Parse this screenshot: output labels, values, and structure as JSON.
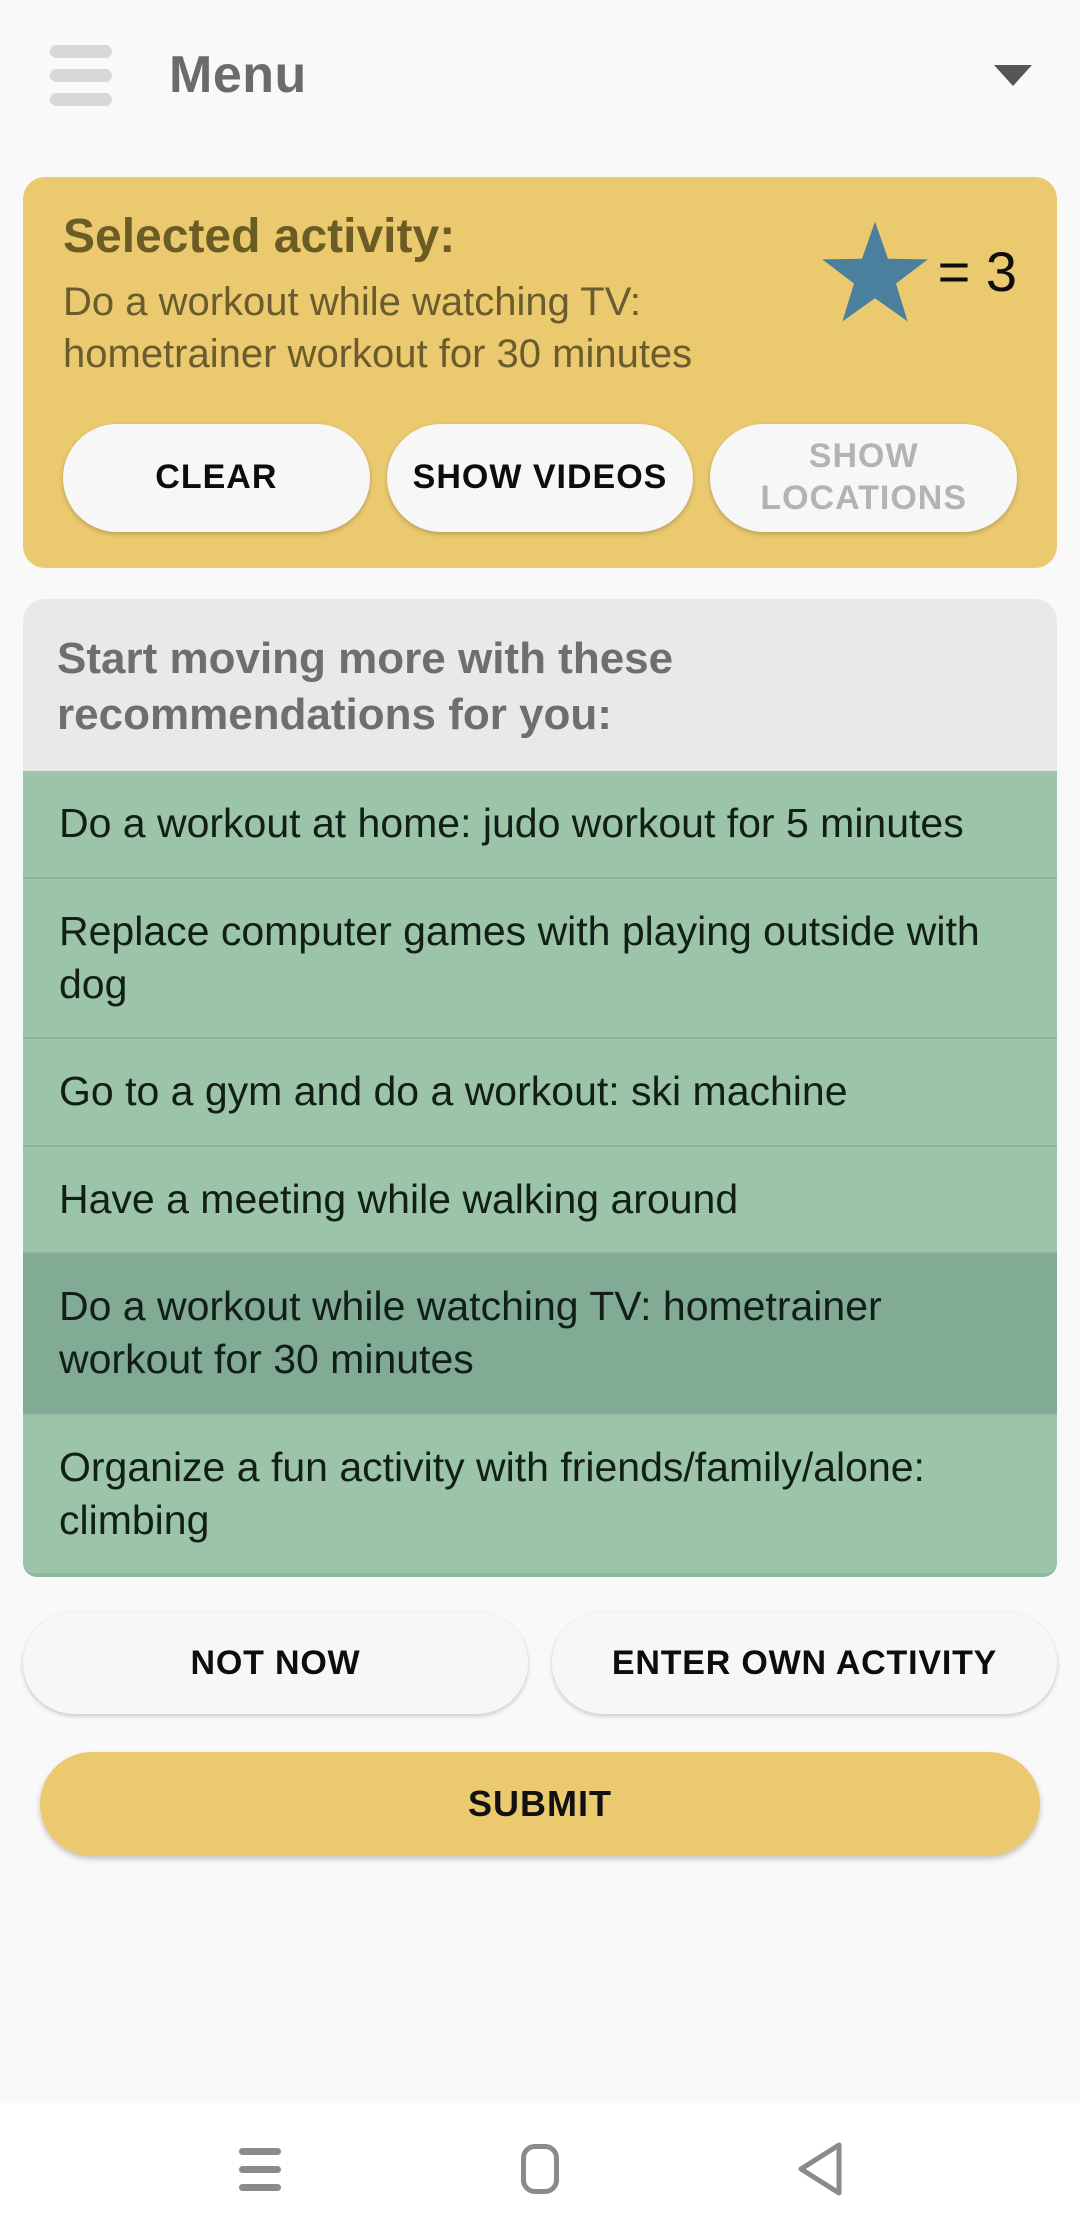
{
  "appbar": {
    "menu_icon": "hamburger-icon",
    "title": "Menu",
    "dropdown_icon": "chevron-down-icon"
  },
  "selected_activity": {
    "heading": "Selected activity:",
    "description": "Do a workout while watching TV: hometrainer workout for 30 minutes",
    "star_icon": "star-icon",
    "star_color": "#4a7f9e",
    "points_label": "= 3",
    "points_value": 3,
    "buttons": [
      {
        "label": "CLEAR",
        "enabled": true
      },
      {
        "label": "SHOW VIDEOS",
        "enabled": true
      },
      {
        "label": "SHOW LOCATIONS",
        "enabled": false
      }
    ]
  },
  "recommendations": {
    "header": "Start moving more with these recommendations for you:",
    "items": [
      {
        "text": "Do a workout at home: judo workout for 5 minutes",
        "selected": false
      },
      {
        "text": "Replace computer games with playing outside with dog",
        "selected": false
      },
      {
        "text": "Go to a gym and do a workout: ski machine",
        "selected": false
      },
      {
        "text": "Have a meeting while walking around",
        "selected": false
      },
      {
        "text": "Do a workout while watching TV: hometrainer workout for 30 minutes",
        "selected": true
      },
      {
        "text": "Organize a fun activity with friends/family/alone: climbing",
        "selected": false
      }
    ]
  },
  "actions": {
    "not_now": "NOT NOW",
    "enter_own_activity": "ENTER OWN ACTIVITY",
    "submit": "SUBMIT"
  },
  "navbar": {
    "recents_icon": "recents-icon",
    "home_icon": "home-icon",
    "back_icon": "back-icon"
  },
  "colors": {
    "accent_yellow": "#ebc96f",
    "list_green": "#9cc4a8",
    "list_green_selected": "#82ab95",
    "header_grey": "#e9e9e9",
    "star_blue": "#4a7f9e"
  }
}
